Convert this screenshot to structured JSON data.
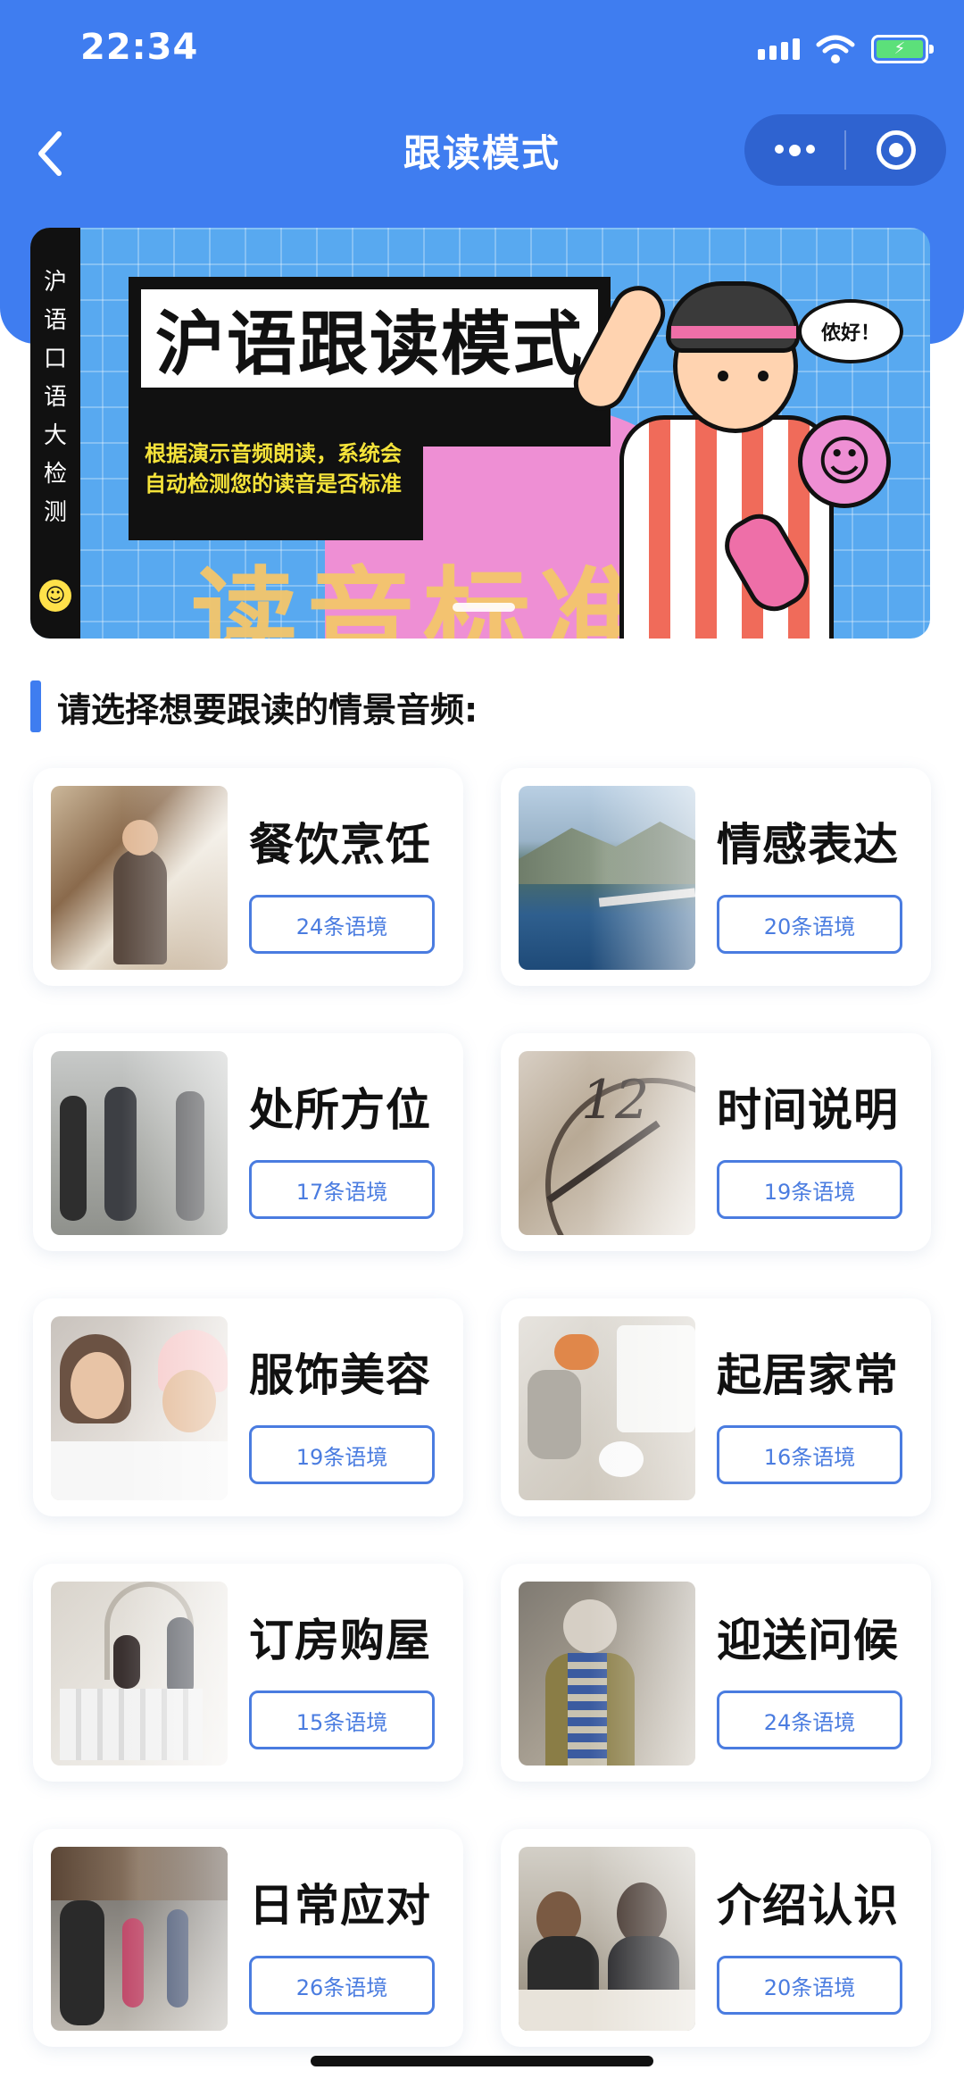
{
  "status_bar": {
    "time": "22:34"
  },
  "nav": {
    "title": "跟读模式"
  },
  "banner": {
    "side_text": "沪语口语大检测",
    "headline": "沪语跟读模式",
    "description": "根据演示音频朗读，系统会自动检测您的读音是否标准",
    "background_text": "读音标准",
    "speech_bubble": "侬好！"
  },
  "section": {
    "title": "请选择想要跟读的情景音频:"
  },
  "categories": [
    {
      "name": "餐饮烹饪",
      "count": "24条语境",
      "icon": "restaurant-photo"
    },
    {
      "name": "情感表达",
      "count": "20条语境",
      "icon": "lake-photo"
    },
    {
      "name": "处所方位",
      "count": "17条语境",
      "icon": "walking-people-photo"
    },
    {
      "name": "时间说明",
      "count": "19条语境",
      "icon": "clock-photo"
    },
    {
      "name": "服饰美容",
      "count": "19条语境",
      "icon": "beauty-photo"
    },
    {
      "name": "起居家常",
      "count": "16条语境",
      "icon": "bedroom-photo"
    },
    {
      "name": "订房购屋",
      "count": "15条语境",
      "icon": "real-estate-photo"
    },
    {
      "name": "迎送问候",
      "count": "24条语境",
      "icon": "greeting-photo"
    },
    {
      "name": "日常应对",
      "count": "26条语境",
      "icon": "street-photo"
    },
    {
      "name": "介绍认识",
      "count": "20条语境",
      "icon": "meeting-photo"
    }
  ],
  "colors": {
    "primary": "#3f7df0",
    "button_border": "#4a7ce0"
  }
}
